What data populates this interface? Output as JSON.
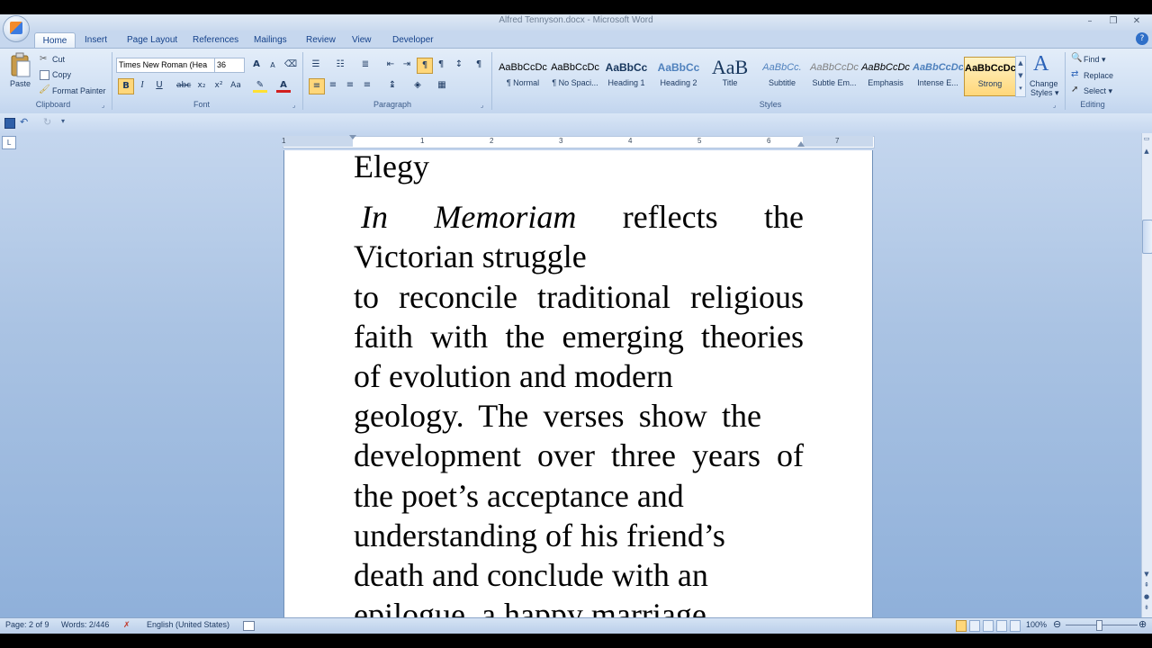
{
  "window": {
    "title": "Alfred Tennyson.docx - Microsoft Word",
    "minimize": "–",
    "restore": "❐",
    "close": "✕"
  },
  "tabs": [
    "Home",
    "Insert",
    "Page Layout",
    "References",
    "Mailings",
    "Review",
    "View",
    "Developer"
  ],
  "ribbon": {
    "clipboard": {
      "paste": "Paste",
      "cut": "Cut",
      "copy": "Copy",
      "format_painter": "Format Painter",
      "label": "Clipboard"
    },
    "font": {
      "font_name": "Times New Roman (Hea",
      "font_size": "36",
      "label": "Font"
    },
    "paragraph": {
      "label": "Paragraph"
    },
    "styles": {
      "label": "Styles",
      "items": [
        {
          "sample": "AaBbCcDc",
          "name": "¶ Normal"
        },
        {
          "sample": "AaBbCcDc",
          "name": "¶ No Spaci..."
        },
        {
          "sample": "AaBbCc",
          "name": "Heading 1"
        },
        {
          "sample": "AaBbCc",
          "name": "Heading 2"
        },
        {
          "sample": "AaB",
          "name": "Title"
        },
        {
          "sample": "AaBbCc.",
          "name": "Subtitle"
        },
        {
          "sample": "AaBbCcDc",
          "name": "Subtle Em..."
        },
        {
          "sample": "AaBbCcDc",
          "name": "Emphasis"
        },
        {
          "sample": "AaBbCcDc",
          "name": "Intense E..."
        },
        {
          "sample": "AaBbCcDc",
          "name": "Strong"
        }
      ],
      "change_styles_line1": "Change",
      "change_styles_line2": "Styles ▾"
    },
    "editing": {
      "find": "Find ▾",
      "replace": "Replace",
      "select": "Select ▾",
      "label": "Editing"
    }
  },
  "ruler": {
    "numbers": [
      "1",
      "1",
      "2",
      "3",
      "4",
      "5",
      "6",
      "7"
    ]
  },
  "document": {
    "heading": "Elegy",
    "italic_title": "In Memoriam",
    "lines": [
      " reflects the",
      "Victorian struggle",
      "to reconcile traditional religious",
      "faith with the emerging theories",
      "of evolution and modern",
      "geology. The verses show the",
      "development over three years of",
      "the poet’s acceptance and",
      "understanding of his friend’s",
      "death and conclude with an",
      "epilogue, a happy marriage"
    ]
  },
  "statusbar": {
    "page": "Page: 2 of 9",
    "words": "Words: 2/446",
    "language": "English (United States)",
    "zoom": "100%"
  }
}
